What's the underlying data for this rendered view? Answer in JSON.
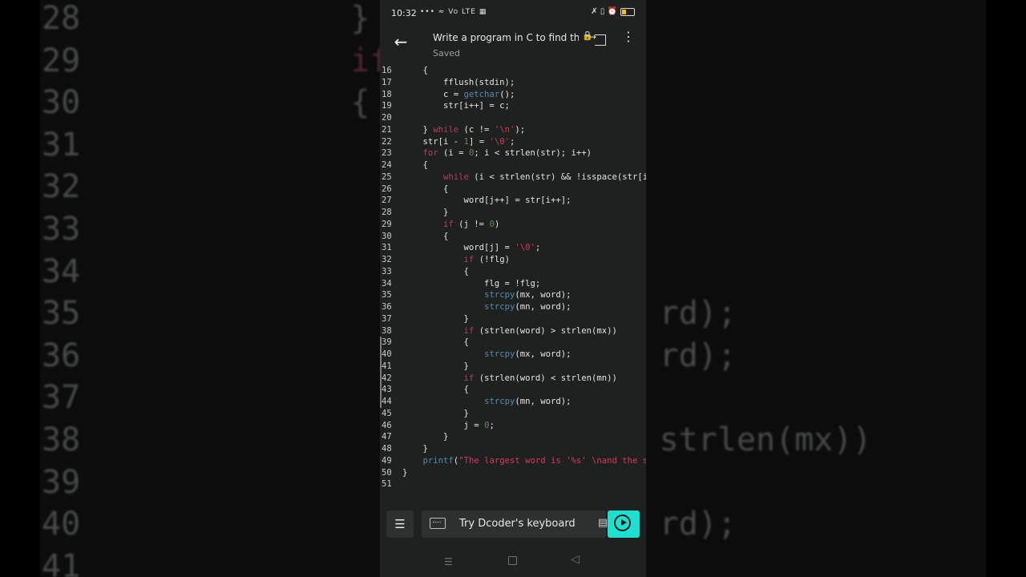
{
  "status_bar": {
    "time": "10:32",
    "left_icons": "••• ≈ Vo LTE ▦",
    "right_icons": "✗ ▯ ⏰"
  },
  "header": {
    "title": "Write a program in C to find the largest and smallest word",
    "save_status": "Saved"
  },
  "editor": {
    "lines": [
      {
        "n": "16",
        "segs": [
          [
            "",
            "    {"
          ]
        ]
      },
      {
        "n": "17",
        "segs": [
          [
            "",
            "        fflush(stdin);"
          ]
        ]
      },
      {
        "n": "18",
        "segs": [
          [
            "",
            "        c = "
          ],
          [
            "fn",
            "getchar"
          ],
          [
            "",
            "();"
          ]
        ]
      },
      {
        "n": "19",
        "segs": [
          [
            "",
            "        str[i++] = c;"
          ]
        ]
      },
      {
        "n": "20",
        "segs": [
          [
            "",
            ""
          ]
        ]
      },
      {
        "n": "21",
        "segs": [
          [
            "",
            "    } "
          ],
          [
            "kw",
            "while"
          ],
          [
            "",
            " (c != "
          ],
          [
            "str",
            "'\\n'"
          ],
          [
            "",
            ");"
          ]
        ]
      },
      {
        "n": "22",
        "segs": [
          [
            "",
            "    str[i - "
          ],
          [
            "num",
            "1"
          ],
          [
            "",
            "] = "
          ],
          [
            "str",
            "'\\0'"
          ],
          [
            "",
            ";"
          ]
        ]
      },
      {
        "n": "23",
        "segs": [
          [
            "",
            "    "
          ],
          [
            "kw",
            "for"
          ],
          [
            "",
            " (i = "
          ],
          [
            "num",
            "0"
          ],
          [
            "",
            "; i < strlen(str); i++)"
          ]
        ]
      },
      {
        "n": "24",
        "segs": [
          [
            "",
            "    {"
          ]
        ]
      },
      {
        "n": "25",
        "segs": [
          [
            "",
            "        "
          ],
          [
            "kw",
            "while"
          ],
          [
            "",
            " (i < strlen(str) && !isspace(str[i]))"
          ]
        ]
      },
      {
        "n": "26",
        "segs": [
          [
            "",
            "        {"
          ]
        ]
      },
      {
        "n": "27",
        "segs": [
          [
            "",
            "            word[j++] = str[i++];"
          ]
        ]
      },
      {
        "n": "28",
        "segs": [
          [
            "",
            "        }"
          ]
        ]
      },
      {
        "n": "29",
        "segs": [
          [
            "",
            "        "
          ],
          [
            "kw",
            "if"
          ],
          [
            "",
            " (j != "
          ],
          [
            "num",
            "0"
          ],
          [
            "",
            ")"
          ]
        ]
      },
      {
        "n": "30",
        "segs": [
          [
            "",
            "        {"
          ]
        ]
      },
      {
        "n": "31",
        "segs": [
          [
            "",
            "            word[j] = "
          ],
          [
            "str",
            "'\\0'"
          ],
          [
            "",
            ";"
          ]
        ]
      },
      {
        "n": "32",
        "segs": [
          [
            "",
            "            "
          ],
          [
            "kw",
            "if"
          ],
          [
            "",
            " (!flg)"
          ]
        ]
      },
      {
        "n": "33",
        "segs": [
          [
            "",
            "            {"
          ]
        ]
      },
      {
        "n": "34",
        "segs": [
          [
            "",
            "                flg = !flg;"
          ]
        ]
      },
      {
        "n": "35",
        "segs": [
          [
            "",
            "                "
          ],
          [
            "fn",
            "strcpy"
          ],
          [
            "",
            "(mx, word);"
          ]
        ]
      },
      {
        "n": "36",
        "segs": [
          [
            "",
            "                "
          ],
          [
            "fn",
            "strcpy"
          ],
          [
            "",
            "(mn, word);"
          ]
        ]
      },
      {
        "n": "37",
        "segs": [
          [
            "",
            "            }"
          ]
        ]
      },
      {
        "n": "38",
        "segs": [
          [
            "",
            "            "
          ],
          [
            "kw",
            "if"
          ],
          [
            "",
            " (strlen(word) > strlen(mx))"
          ]
        ]
      },
      {
        "n": "39",
        "segs": [
          [
            "",
            "            {"
          ]
        ]
      },
      {
        "n": "40",
        "segs": [
          [
            "",
            "                "
          ],
          [
            "fn",
            "strcpy"
          ],
          [
            "",
            "(mx, word);"
          ]
        ]
      },
      {
        "n": "41",
        "segs": [
          [
            "",
            "            }"
          ]
        ]
      },
      {
        "n": "42",
        "segs": [
          [
            "",
            "            "
          ],
          [
            "kw",
            "if"
          ],
          [
            "",
            " (strlen(word) < strlen(mn))"
          ]
        ]
      },
      {
        "n": "43",
        "segs": [
          [
            "",
            "            {"
          ]
        ]
      },
      {
        "n": "44",
        "segs": [
          [
            "",
            "                "
          ],
          [
            "fn",
            "strcpy"
          ],
          [
            "",
            "(mn, word);"
          ]
        ]
      },
      {
        "n": "45",
        "segs": [
          [
            "",
            "            }"
          ]
        ]
      },
      {
        "n": "46",
        "segs": [
          [
            "",
            "            j = "
          ],
          [
            "num",
            "0"
          ],
          [
            "",
            ";"
          ]
        ]
      },
      {
        "n": "47",
        "segs": [
          [
            "",
            "        }"
          ]
        ]
      },
      {
        "n": "48",
        "segs": [
          [
            "",
            "    }"
          ]
        ]
      },
      {
        "n": "49",
        "segs": [
          [
            "",
            "    "
          ],
          [
            "fn",
            "printf"
          ],
          [
            "",
            "("
          ],
          [
            "str",
            "\"The largest word is '%s' \\nand the smallest word is '%s'\""
          ]
        ]
      },
      {
        "n": "50",
        "segs": [
          [
            "",
            "}"
          ]
        ]
      },
      {
        "n": "51",
        "segs": [
          [
            "",
            ""
          ]
        ]
      }
    ]
  },
  "bottom_bar": {
    "keyboard_prompt": "Try Dcoder's keyboard"
  },
  "background": {
    "lines": [
      {
        "n": "28",
        "segs": [
          [
            "",
            "            }"
          ]
        ]
      },
      {
        "n": "29",
        "segs": [
          [
            "",
            "            "
          ],
          [
            "kw",
            "if"
          ],
          [
            "",
            " (j"
          ]
        ]
      },
      {
        "n": "30",
        "segs": [
          [
            "",
            "            {"
          ]
        ]
      },
      {
        "n": "31",
        "segs": [
          [
            "",
            "                wo"
          ]
        ]
      },
      {
        "n": "32",
        "segs": [
          [
            "",
            "                "
          ],
          [
            "kw",
            "if"
          ]
        ]
      },
      {
        "n": "33",
        "segs": [
          [
            "",
            "                {"
          ]
        ]
      },
      {
        "n": "34",
        "segs": [
          [
            "",
            ""
          ]
        ]
      },
      {
        "n": "35",
        "segs": [
          [
            "",
            "                            rd);"
          ]
        ]
      },
      {
        "n": "36",
        "segs": [
          [
            "",
            "                            rd);"
          ]
        ]
      },
      {
        "n": "37",
        "segs": [
          [
            "",
            "                }"
          ]
        ]
      },
      {
        "n": "38",
        "segs": [
          [
            "",
            "                "
          ],
          [
            "kw",
            "if"
          ],
          [
            "",
            "        > strlen(mx))"
          ]
        ]
      },
      {
        "n": "39",
        "segs": [
          [
            "",
            "                {"
          ]
        ]
      },
      {
        "n": "40",
        "segs": [
          [
            "",
            "                            rd);"
          ]
        ]
      },
      {
        "n": "41",
        "segs": [
          [
            "",
            "                }"
          ]
        ]
      }
    ]
  }
}
